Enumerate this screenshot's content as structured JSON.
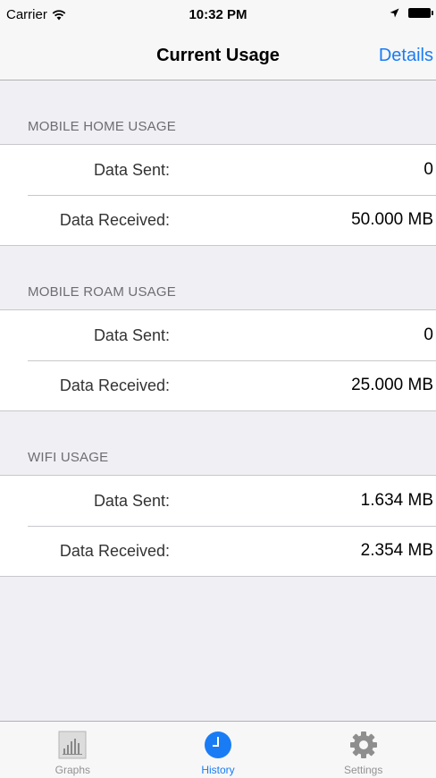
{
  "status_bar": {
    "carrier": "Carrier",
    "time": "10:32 PM",
    "wifi_icon": "wifi-icon",
    "location_icon": "location-arrow-icon",
    "battery_icon": "battery-icon"
  },
  "nav": {
    "title": "Current Usage",
    "details_label": "Details",
    "accent_color": "#1a7cf5"
  },
  "sections": [
    {
      "header": "MOBILE HOME USAGE",
      "rows": [
        {
          "label": "Data Sent:",
          "value": "0"
        },
        {
          "label": "Data Received:",
          "value": "50.000 MB"
        }
      ]
    },
    {
      "header": "MOBILE ROAM USAGE",
      "rows": [
        {
          "label": "Data Sent:",
          "value": "0"
        },
        {
          "label": "Data Received:",
          "value": "25.000 MB"
        }
      ]
    },
    {
      "header": "WIFI USAGE",
      "rows": [
        {
          "label": "Data Sent:",
          "value": "1.634 MB"
        },
        {
          "label": "Data Received:",
          "value": "2.354 MB"
        }
      ]
    }
  ],
  "tab_bar": {
    "tabs": [
      {
        "label": "Graphs",
        "icon": "bar-chart-icon",
        "active": false
      },
      {
        "label": "History",
        "icon": "clock-icon",
        "active": true
      },
      {
        "label": "Settings",
        "icon": "gear-icon",
        "active": false
      }
    ]
  }
}
